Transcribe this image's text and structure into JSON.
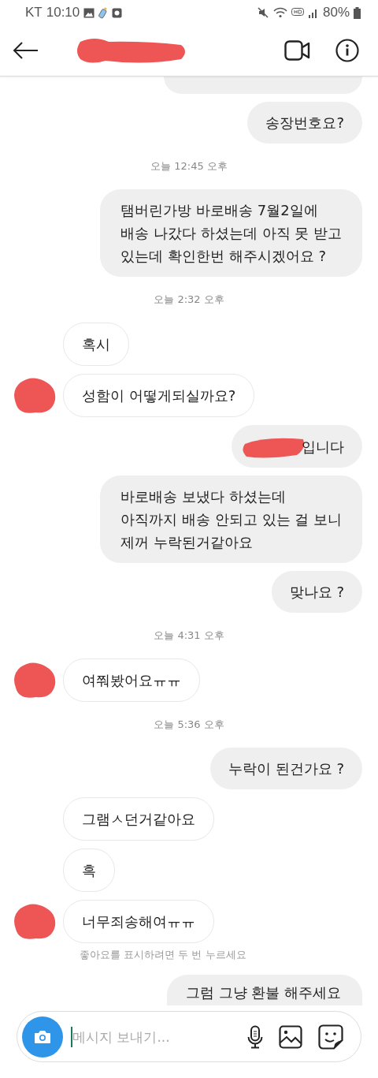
{
  "status_bar": {
    "carrier": "KT",
    "time": "10:10",
    "battery": "80%"
  },
  "messages": [
    {
      "kind": "sent_cut"
    },
    {
      "kind": "sent",
      "text": "송장번호요?"
    },
    {
      "kind": "timestamp",
      "text": "오늘 12:45 오후"
    },
    {
      "kind": "sent",
      "text": "탬버린가방 바로배송 7월2일에\n배송 나갔다 하셨는데 아직 못 받고\n있는데 확인한번 해주시겠어요 ?"
    },
    {
      "kind": "timestamp",
      "text": "오늘 2:32 오후"
    },
    {
      "kind": "received",
      "text": "혹시",
      "avatar": false
    },
    {
      "kind": "received",
      "text": "성함이 어떻게되실까요?",
      "avatar": true
    },
    {
      "kind": "sent",
      "text": "입니다",
      "redacted": true
    },
    {
      "kind": "sent",
      "text": "바로배송 보냈다 하셨는데\n아직까지 배송 안되고 있는 걸 보니\n제꺼 누락된거같아요"
    },
    {
      "kind": "sent",
      "text": "맞나요 ?"
    },
    {
      "kind": "timestamp",
      "text": "오늘 4:31 오후"
    },
    {
      "kind": "received",
      "text": "여쭤봤어요ㅠㅠ",
      "avatar": true
    },
    {
      "kind": "timestamp",
      "text": "오늘 5:36 오후"
    },
    {
      "kind": "sent",
      "text": "누락이 된건가요 ?"
    },
    {
      "kind": "received",
      "text": "그램ㅅ던거같아요",
      "avatar": false
    },
    {
      "kind": "received",
      "text": "흑",
      "avatar": false
    },
    {
      "kind": "received",
      "text": "너무죄송해여ㅠㅠ",
      "avatar": true
    },
    {
      "kind": "hint",
      "text": "좋아요를 표시하려면 두 번 누르세요"
    },
    {
      "kind": "sent_bottom",
      "text": "그럼 그냥 환불 해주세요"
    }
  ],
  "composer": {
    "placeholder": "메시지 보내기..."
  }
}
